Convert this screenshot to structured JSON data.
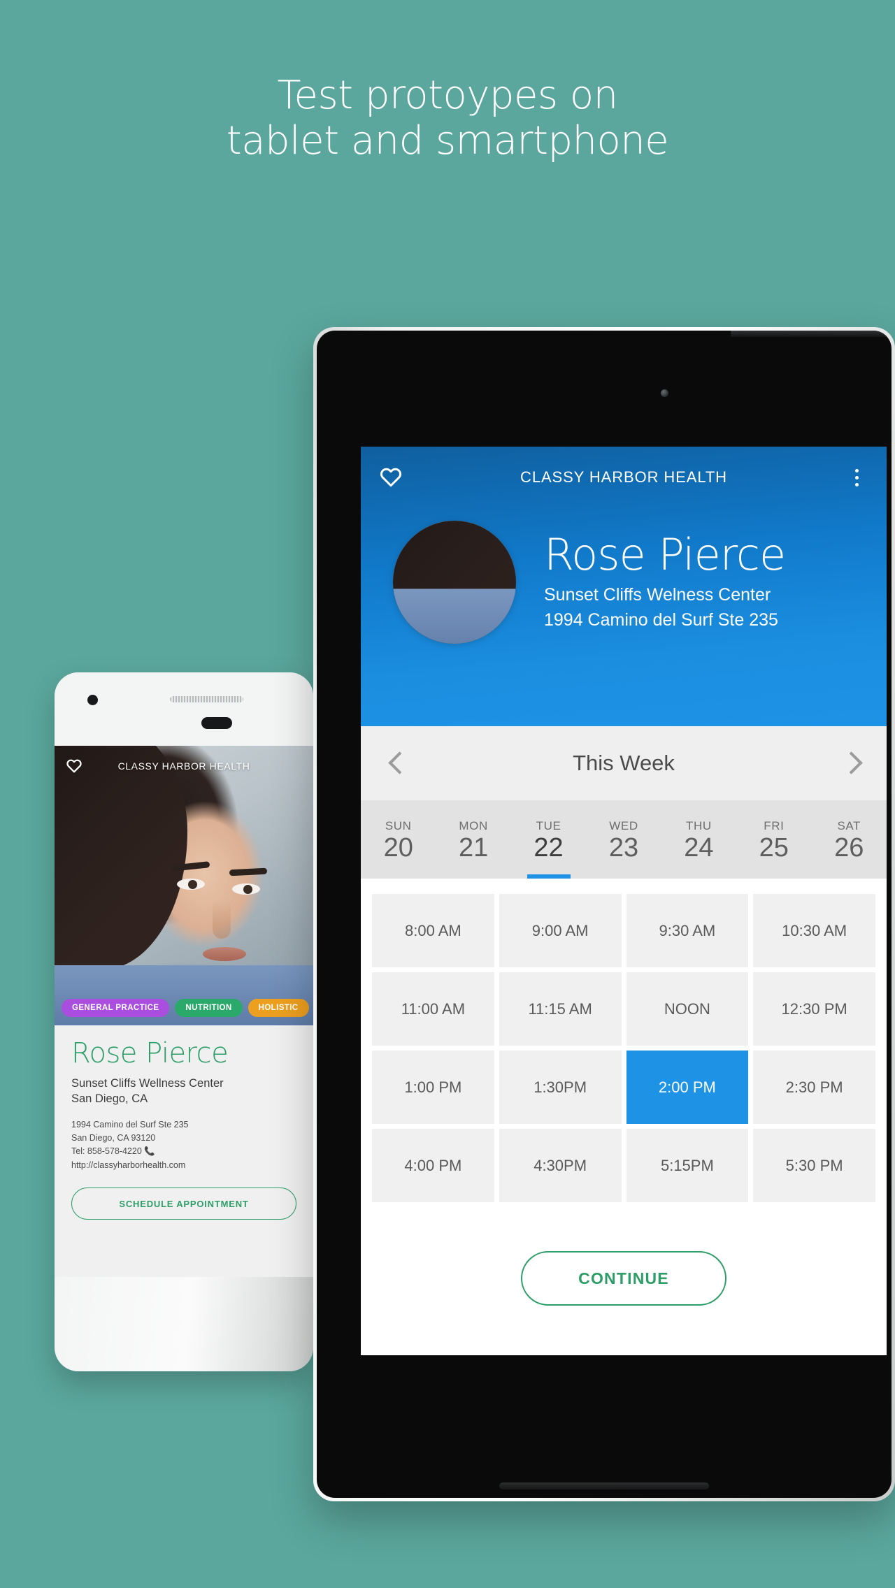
{
  "page": {
    "background_color": "#5ba79d",
    "headline_line1": "Test protoypes on",
    "headline_line2": "tablet and smartphone"
  },
  "colors": {
    "teal_background": "#5ba79d",
    "brand_blue": "#1e93e6",
    "header_blue_dark": "#0f5f9f",
    "green_accent": "#2e9e68",
    "tag_purple": "#a94ede",
    "tag_green": "#2aa96a",
    "tag_orange": "#eda01f"
  },
  "phone": {
    "app_title": "CLASSY HARBOR HEALTH",
    "favorite_icon": "heart-icon",
    "tags": [
      {
        "label": "GENERAL PRACTICE",
        "color": "#a94ede"
      },
      {
        "label": "NUTRITION",
        "color": "#2aa96a"
      },
      {
        "label": "HOLISTIC",
        "color": "#eda01f"
      }
    ],
    "provider_name": "Rose Pierce",
    "facility_line1": "Sunset Cliffs Wellness Center",
    "facility_line2": "San Diego, CA",
    "address_line1": "1994 Camino del Surf Ste 235",
    "address_line2": "San Diego, CA 93120",
    "phone_line": "Tel: 858-578-4220",
    "phone_icon": "phone-icon",
    "website": "http://classyharborhealth.com",
    "schedule_button": "SCHEDULE APPOINTMENT"
  },
  "tablet": {
    "app_title": "CLASSY HARBOR HEALTH",
    "favorite_icon": "heart-icon",
    "overflow_icon": "kebab-menu-icon",
    "avatar_icon": "avatar",
    "provider_name": "Rose Pierce",
    "facility_line": "Sunset Cliffs Welness Center",
    "address_line": "1994 Camino del Surf Ste 235",
    "week": {
      "prev_icon": "chevron-left-icon",
      "next_icon": "chevron-right-icon",
      "label": "This Week",
      "days": [
        {
          "dow": "SUN",
          "num": "20",
          "selected": false
        },
        {
          "dow": "MON",
          "num": "21",
          "selected": false
        },
        {
          "dow": "TUE",
          "num": "22",
          "selected": true
        },
        {
          "dow": "WED",
          "num": "23",
          "selected": false
        },
        {
          "dow": "THU",
          "num": "24",
          "selected": false
        },
        {
          "dow": "FRI",
          "num": "25",
          "selected": false
        },
        {
          "dow": "SAT",
          "num": "26",
          "selected": false
        }
      ]
    },
    "time_slots": [
      {
        "label": "8:00 AM",
        "selected": false
      },
      {
        "label": "9:00 AM",
        "selected": false
      },
      {
        "label": "9:30 AM",
        "selected": false
      },
      {
        "label": "10:30 AM",
        "selected": false
      },
      {
        "label": "11:00 AM",
        "selected": false
      },
      {
        "label": "11:15 AM",
        "selected": false
      },
      {
        "label": "NOON",
        "selected": false
      },
      {
        "label": "12:30 PM",
        "selected": false
      },
      {
        "label": "1:00 PM",
        "selected": false
      },
      {
        "label": "1:30PM",
        "selected": false
      },
      {
        "label": "2:00 PM",
        "selected": true
      },
      {
        "label": "2:30 PM",
        "selected": false
      },
      {
        "label": "4:00 PM",
        "selected": false
      },
      {
        "label": "4:30PM",
        "selected": false
      },
      {
        "label": "5:15PM",
        "selected": false
      },
      {
        "label": "5:30 PM",
        "selected": false
      }
    ],
    "continue_button": "CONTINUE"
  }
}
